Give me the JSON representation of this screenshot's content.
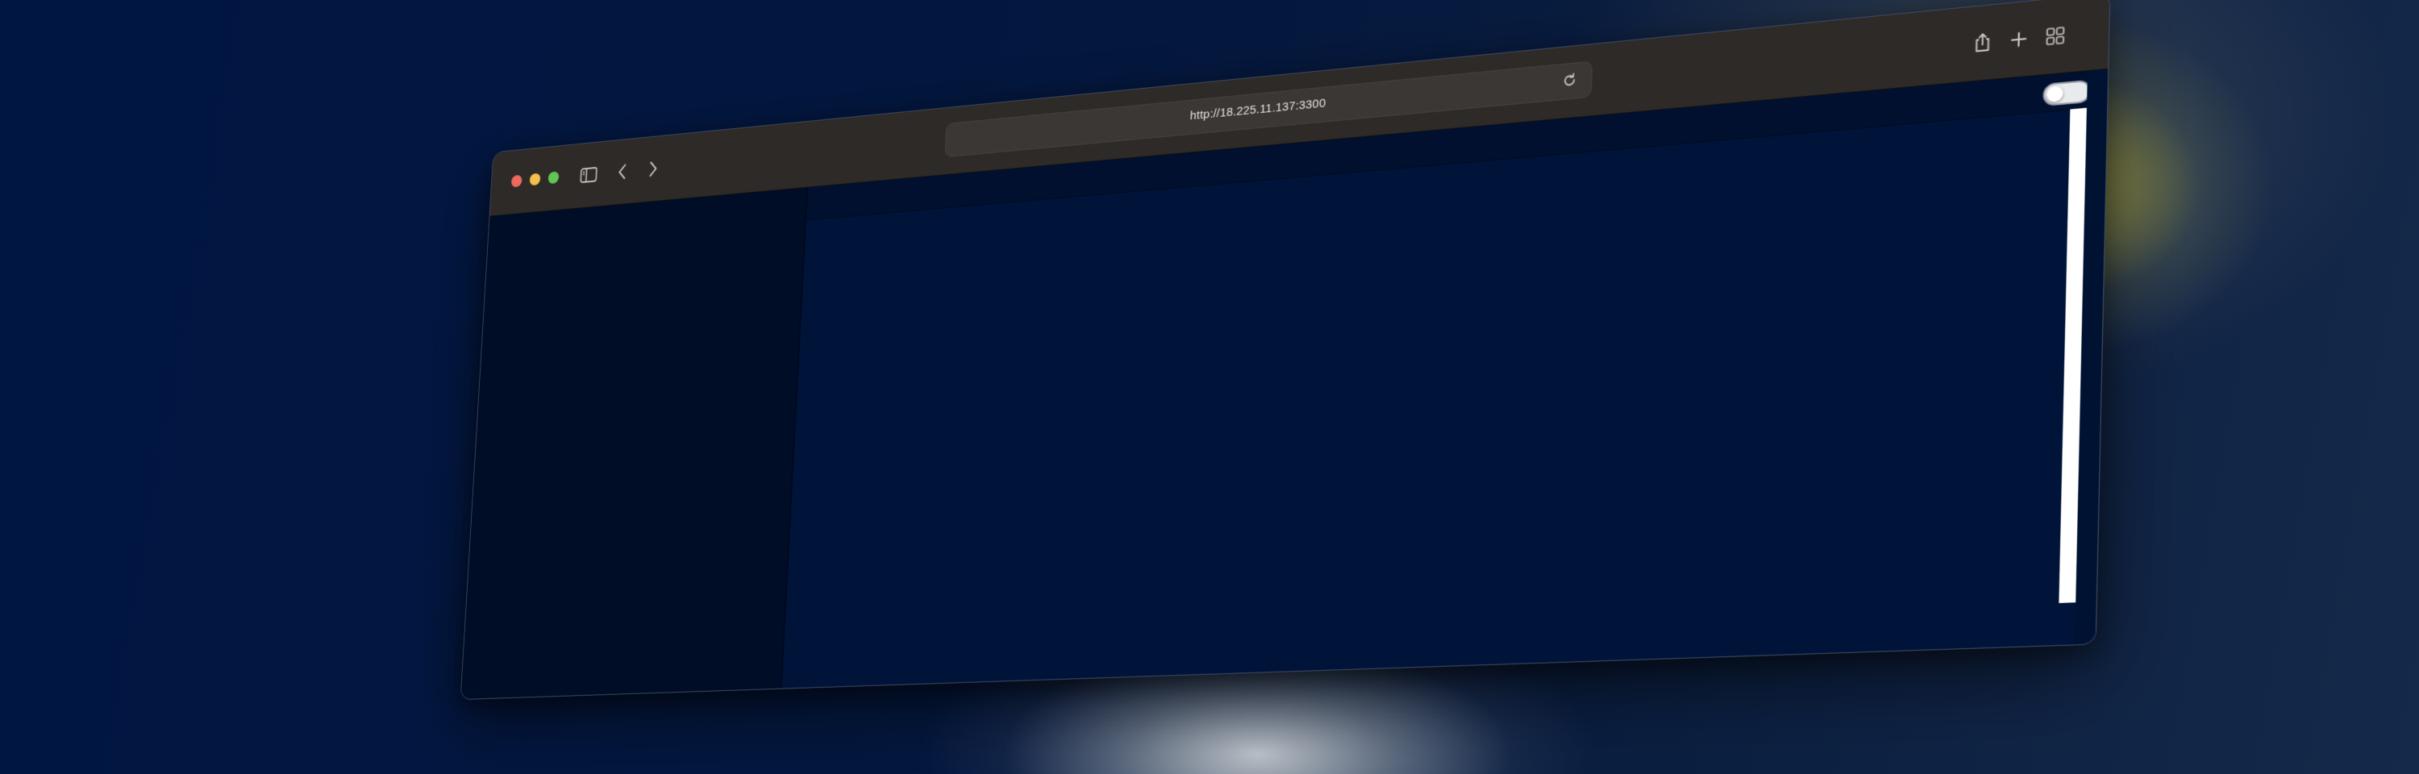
{
  "browser": {
    "url": "http://18.225.11.137:3300",
    "icons": {
      "sidebar": "sidebar-icon",
      "back": "chevron-left-icon",
      "forward": "chevron-right-icon",
      "reload": "reload-icon",
      "share": "share-icon",
      "new_tab": "plus-icon",
      "tab_overview": "grid-icon"
    },
    "traffic_lights": [
      "#ec6a5e",
      "#f4bf4f",
      "#61c554"
    ]
  },
  "page": {
    "theme_toggle": {
      "state": "off"
    },
    "colors": {
      "background": "#001339",
      "sidebar": "#000d26",
      "topbar": "#00102e"
    }
  }
}
